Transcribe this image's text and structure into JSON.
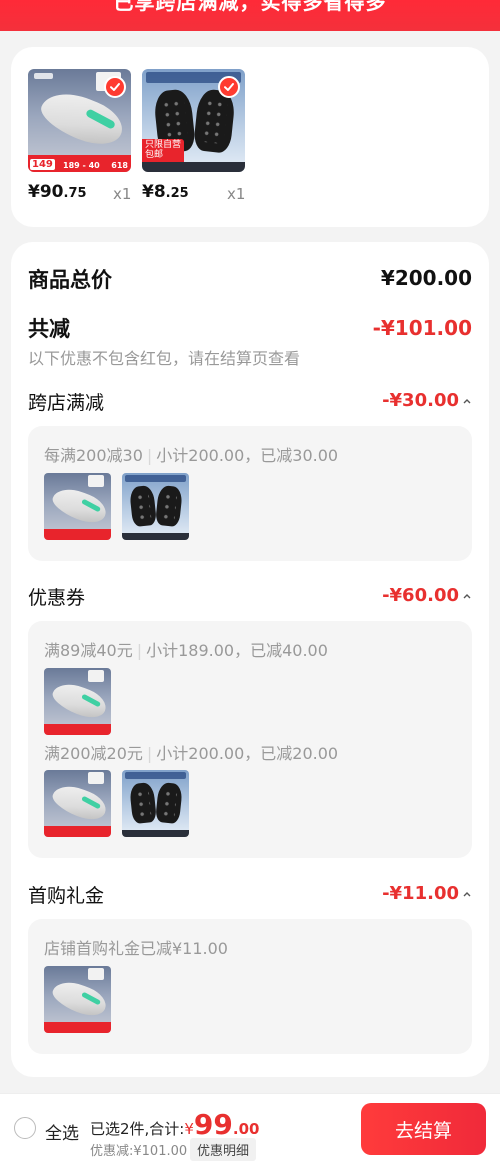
{
  "banner": {
    "text": "已享跨店满减，实得多省得多"
  },
  "products": [
    {
      "name": "shoe",
      "price_int": "¥90",
      "price_dec": ".75",
      "qty": "x1",
      "strip_left": "149",
      "strip_mid": "189 - 40",
      "strip_right": "618"
    },
    {
      "name": "ice-cleat",
      "price_int": "¥8",
      "price_dec": ".25",
      "qty": "x1",
      "tag_line1": "只限自营",
      "tag_line2": "包邮"
    }
  ],
  "summary": {
    "total_label": "商品总价",
    "total_value": "¥200.00",
    "discount_label": "共减",
    "discount_value": "-¥101.00",
    "discount_note": "以下优惠不包含红包，请在结算页查看"
  },
  "sections": [
    {
      "title": "跨店满减",
      "value": "-¥30.00",
      "lines": [
        {
          "left": "每满200减30",
          "right": "小计200.00，已减30.00"
        }
      ]
    },
    {
      "title": "优惠券",
      "value": "-¥60.00",
      "lines": [
        {
          "left": "满89减40元",
          "right": "小计189.00，已减40.00"
        },
        {
          "left": "满200减20元",
          "right": "小计200.00，已减20.00"
        }
      ]
    },
    {
      "title": "首购礼金",
      "value": "-¥11.00",
      "lines": [
        {
          "left": "店铺首购礼金已减¥11.00",
          "right": ""
        }
      ]
    }
  ],
  "bottom": {
    "select_all": "全选",
    "selected_text": "已选2件,合计:",
    "currency": "¥",
    "amount_int": "99",
    "amount_dec": ".00",
    "discount_text": "优惠减:¥101.00",
    "detail_button": "优惠明细",
    "checkout_button": "去结算"
  },
  "colors": {
    "accent": "#e8302f",
    "banner": "#f4303b"
  }
}
